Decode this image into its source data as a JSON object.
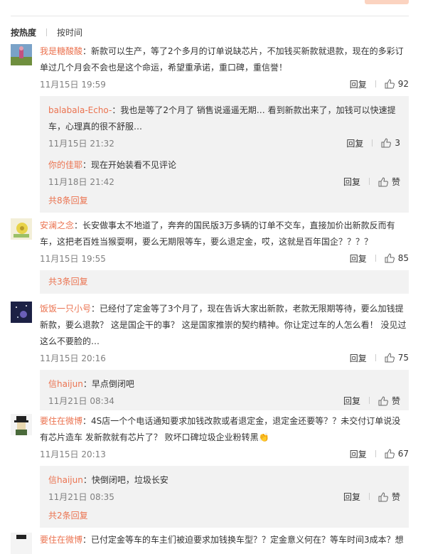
{
  "sort": {
    "active": "按热度",
    "inactive": "按时间"
  },
  "labels": {
    "reply": "回复",
    "like": "赞"
  },
  "comments": [
    {
      "user": "我是糖酸酸",
      "text": "：新款可以生产，等了2个多月的订单说缺芯片，不加钱买新款就退款，现在的多彩订单过几个月会不会也是这个命运，希望重承诺，重口碑，重信誉！",
      "time": "11月15日 19:59",
      "likes": "92",
      "replies": [
        {
          "user": "balabala-Echo-",
          "text": "：我也是等了2个月了 销售说遥遥无期… 看到新款出来了，加钱可以快速提车，心理真的很不舒服…",
          "time": "11月15日 21:32",
          "likes": "3"
        },
        {
          "user": "你的佳耶",
          "text": "：现在开始装看不见评论",
          "time": "11月18日 21:42",
          "likes": "赞"
        }
      ],
      "more": "共8条回复"
    },
    {
      "user": "安澜之念",
      "text": "：长安做事太不地道了，奔奔的国民版3万多辆的订单不交车，直接加价出新款反而有车，这把老百姓当猴耍啊，要么无期限等车，要么退定金，哎，这就是百年国企？？？？",
      "time": "11月15日 19:55",
      "likes": "85",
      "replies": [],
      "more": "共3条回复"
    },
    {
      "user": "饭饭一只小号",
      "text": "：已经付了定金等了3个月了，现在告诉大家出新款，老款无限期等待，要么加钱提新款，要么退款？ 这是国企干的事？ 这是国家推崇的契约精神。你让定过车的人怎么看！ 没见过这么不要脸的…",
      "time": "11月15日 20:16",
      "likes": "75",
      "replies": [
        {
          "user": "信haijun",
          "text": "：早点倒闭吧",
          "time": "11月21日 08:34",
          "likes": "赞"
        }
      ],
      "more": ""
    },
    {
      "user": "要住在微博",
      "text": "：4S店一个个电话通知要求加钱改款或者退定金，退定金还要等？？未交付订单说没有芯片造车 发新款就有芯片了？ 败坏口碑垃圾企业粉转黑👏",
      "time": "11月15日 20:13",
      "likes": "67",
      "replies": [
        {
          "user": "信haijun",
          "text": "：快倒闭吧，垃圾长安",
          "time": "11月21日 08:35",
          "likes": "赞"
        }
      ],
      "more": "共2条回复"
    },
    {
      "user": "要住在微博",
      "text": "：已付定金等车的车主们被迫要求加钱换车型？？定金意义何在？等车时间3成本？想",
      "time": "",
      "likes": "",
      "replies": [],
      "more": ""
    }
  ]
}
